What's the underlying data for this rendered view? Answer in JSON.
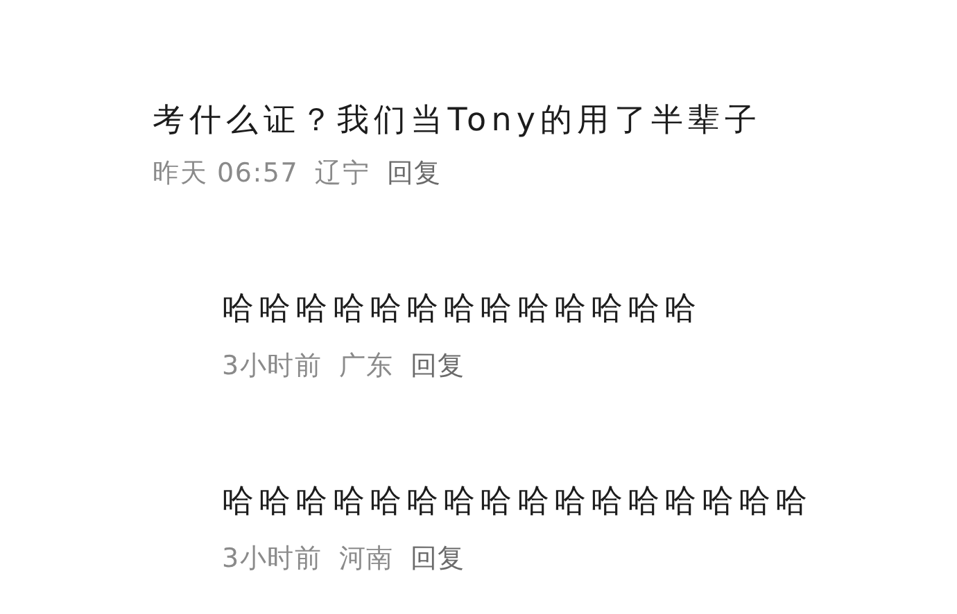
{
  "comments": [
    {
      "text": "考什么证？我们当Tony的用了半辈子",
      "time": "昨天 06:57",
      "region": "辽宁",
      "reply_label": "回复",
      "children": [
        {
          "text": "哈哈哈哈哈哈哈哈哈哈哈哈哈",
          "time": "3小时前",
          "region": "广东",
          "reply_label": "回复"
        },
        {
          "text": "哈哈哈哈哈哈哈哈哈哈哈哈哈哈哈哈",
          "time": "3小时前",
          "region": "河南",
          "reply_label": "回复"
        }
      ]
    }
  ]
}
